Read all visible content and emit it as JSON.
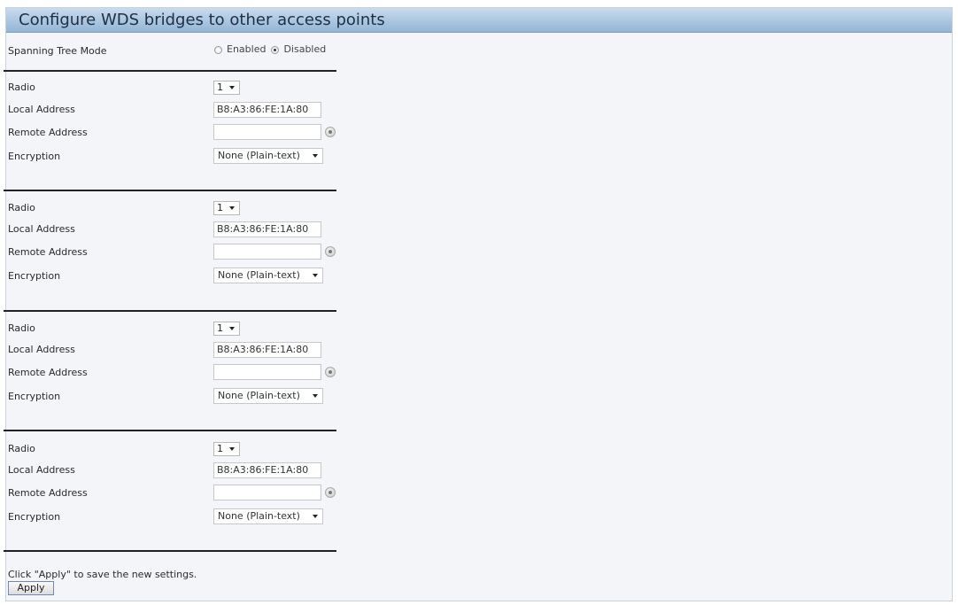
{
  "title": "Configure WDS bridges to other access points",
  "spanning_tree": {
    "label": "Spanning Tree Mode",
    "options": [
      "Enabled",
      "Disabled"
    ],
    "selected": "Disabled"
  },
  "field_labels": {
    "radio": "Radio",
    "local_address": "Local Address",
    "remote_address": "Remote Address",
    "encryption": "Encryption"
  },
  "bridges": [
    {
      "radio": "1",
      "local_address": "B8:A3:86:FE:1A:80",
      "remote_address": "",
      "encryption": "None (Plain-text)"
    },
    {
      "radio": "1",
      "local_address": "B8:A3:86:FE:1A:80",
      "remote_address": "",
      "encryption": "None (Plain-text)"
    },
    {
      "radio": "1",
      "local_address": "B8:A3:86:FE:1A:80",
      "remote_address": "",
      "encryption": "None (Plain-text)"
    },
    {
      "radio": "1",
      "local_address": "B8:A3:86:FE:1A:80",
      "remote_address": "",
      "encryption": "None (Plain-text)"
    }
  ],
  "footer": {
    "hint": "Click \"Apply\" to save the new settings.",
    "apply_label": "Apply"
  }
}
